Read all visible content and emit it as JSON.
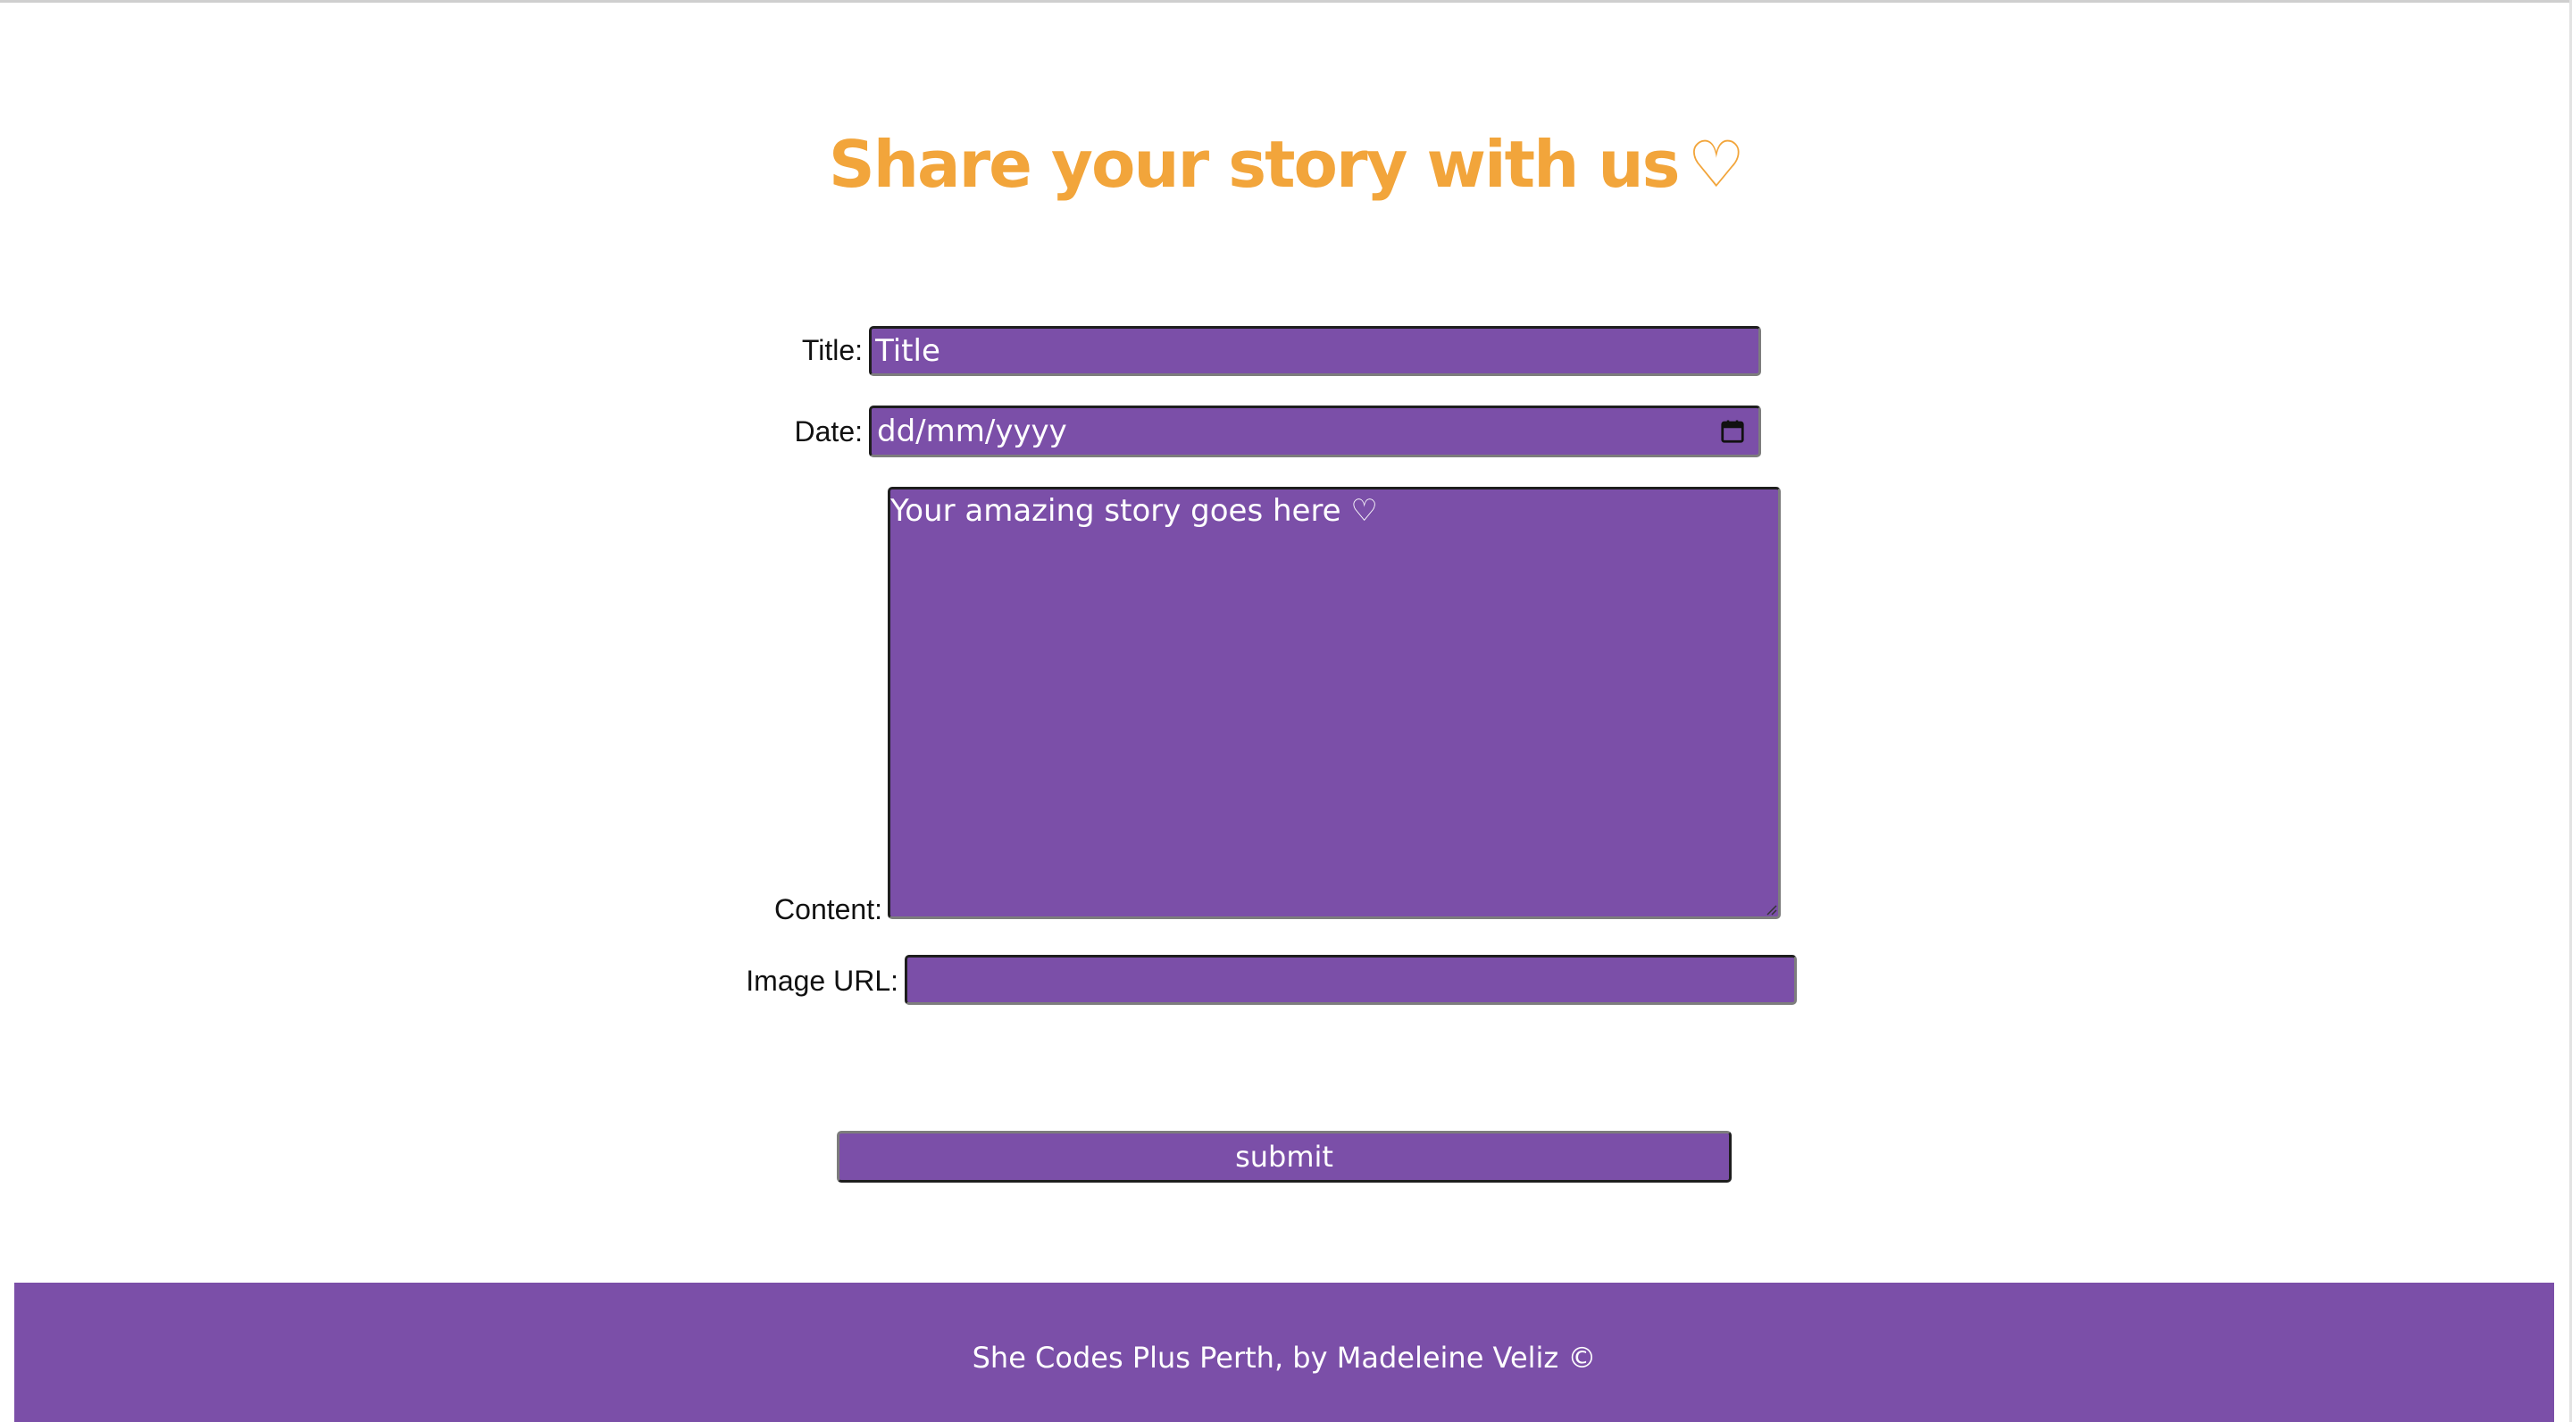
{
  "page": {
    "heading": "Share your story with us",
    "heading_heart": "♡"
  },
  "form": {
    "title_label": "Title:",
    "title_placeholder": "Title",
    "date_label": "Date:",
    "date_placeholder": "dd/mm/yyyy",
    "date_icon": "calendar-icon",
    "content_label": "Content:",
    "content_placeholder": "Your amazing story goes here ♡",
    "image_url_label": "Image URL:",
    "image_url_value": "",
    "submit_label": "submit"
  },
  "footer": {
    "text": "She Codes Plus Perth, by Madeleine Veliz ©"
  },
  "colors": {
    "accent_orange": "#F2A53B",
    "purple": "#7B4FA8",
    "text_dark": "#111111",
    "white": "#FFFFFF"
  }
}
